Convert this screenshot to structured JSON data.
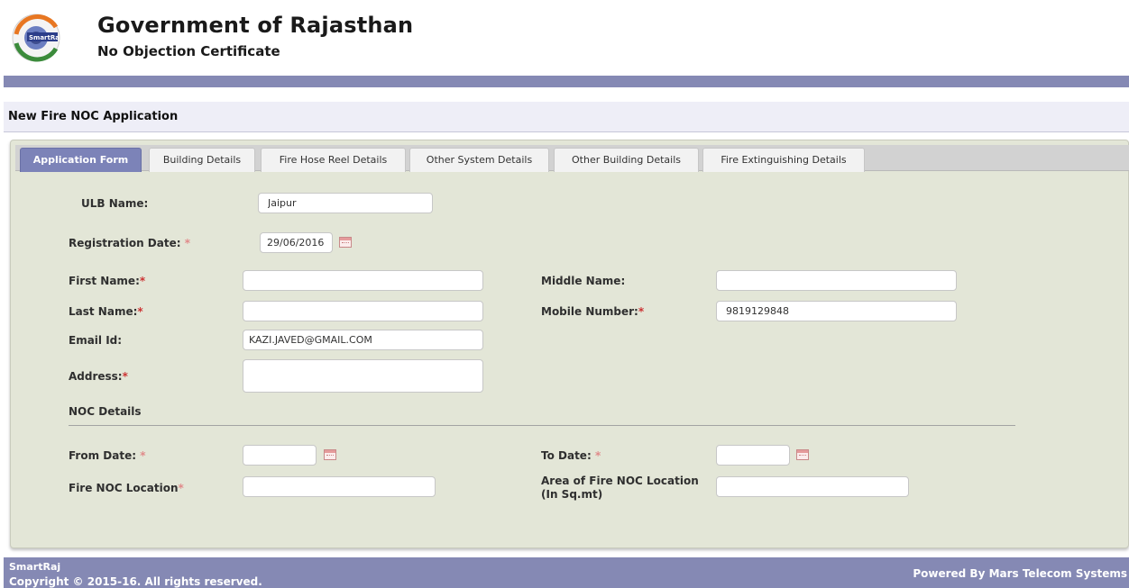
{
  "header": {
    "logo_text": "SmartRaj",
    "title": "Government of Rajasthan",
    "subtitle": "No Objection Certificate"
  },
  "page": {
    "title": "New Fire NOC Application"
  },
  "tabs": [
    {
      "label": "Application Form",
      "active": true
    },
    {
      "label": "Building Details",
      "active": false
    },
    {
      "label": "Fire Hose Reel Details",
      "active": false
    },
    {
      "label": "Other System Details",
      "active": false
    },
    {
      "label": "Other Building Details",
      "active": false
    },
    {
      "label": "Fire Extinguishing Details",
      "active": false
    }
  ],
  "form": {
    "ulb_name": {
      "label": "ULB Name:",
      "value": "Jaipur"
    },
    "registration_date": {
      "label": "Registration Date:",
      "required_mark": "*",
      "value": "29/06/2016"
    },
    "first_name": {
      "label": "First Name:",
      "required_mark": "*",
      "value": ""
    },
    "middle_name": {
      "label": "Middle Name:",
      "value": ""
    },
    "last_name": {
      "label": "Last Name:",
      "required_mark": "*",
      "value": ""
    },
    "mobile_number": {
      "label": "Mobile Number:",
      "required_mark": "*",
      "value": "9819129848"
    },
    "email_id": {
      "label": "Email Id:",
      "value": "KAZI.JAVED@GMAIL.COM"
    },
    "address": {
      "label": "Address:",
      "required_mark": "*",
      "value": ""
    },
    "noc_details": {
      "heading": "NOC Details"
    },
    "from_date": {
      "label": "From Date:",
      "required_mark": "*",
      "value": ""
    },
    "to_date": {
      "label": "To Date:",
      "required_mark": "*",
      "value": ""
    },
    "fire_noc_location": {
      "label": "Fire NOC Location",
      "required_mark": "*",
      "value": ""
    },
    "area_fire_noc_location": {
      "label_line1": "Area of Fire NOC Location",
      "label_line2": "(In Sq.mt)",
      "value": ""
    }
  },
  "footer": {
    "brand": "SmartRaj",
    "copyright": "Copyright © 2015-16. All rights reserved.",
    "powered_by": "Powered By Mars Telecom Systems"
  },
  "colors": {
    "accent": "#8589b4",
    "active_tab": "#7c83b8",
    "panel_bg": "#e3e6d7",
    "required": "#cc3333"
  }
}
